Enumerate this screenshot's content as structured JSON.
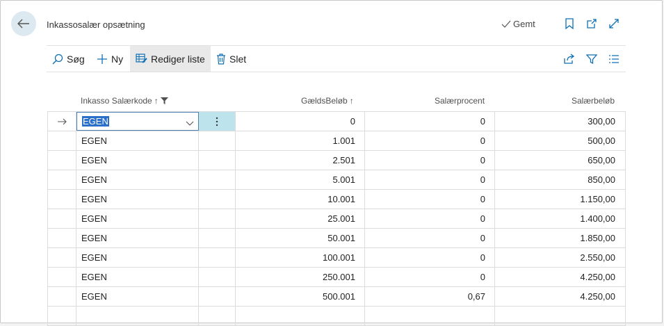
{
  "header": {
    "title": "Inkassosalær opsætning",
    "saved_label": "Gemt"
  },
  "actions": {
    "search": "Søg",
    "new": "Ny",
    "edit_list": "Rediger liste",
    "delete": "Slet"
  },
  "columns": {
    "code": "Inkasso Salærkode",
    "debt_amount": "GældsBeløb",
    "fee_percent": "Salærprocent",
    "fee_amount": "Salærbeløb"
  },
  "rows": [
    {
      "code": "EGEN",
      "debt": "0",
      "percent": "0",
      "fee": "300,00"
    },
    {
      "code": "EGEN",
      "debt": "1.001",
      "percent": "0",
      "fee": "500,00"
    },
    {
      "code": "EGEN",
      "debt": "2.501",
      "percent": "0",
      "fee": "650,00"
    },
    {
      "code": "EGEN",
      "debt": "5.001",
      "percent": "0",
      "fee": "850,00"
    },
    {
      "code": "EGEN",
      "debt": "10.001",
      "percent": "0",
      "fee": "1.150,00"
    },
    {
      "code": "EGEN",
      "debt": "25.001",
      "percent": "0",
      "fee": "1.400,00"
    },
    {
      "code": "EGEN",
      "debt": "50.001",
      "percent": "0",
      "fee": "1.850,00"
    },
    {
      "code": "EGEN",
      "debt": "100.001",
      "percent": "0",
      "fee": "2.550,00"
    },
    {
      "code": "EGEN",
      "debt": "250.001",
      "percent": "0",
      "fee": "4.250,00"
    },
    {
      "code": "EGEN",
      "debt": "500.001",
      "percent": "0,67",
      "fee": "4.250,00"
    }
  ],
  "colors": {
    "accent": "#2a6fc9",
    "icon_blue": "#0e6fb5",
    "selected_row_tint": "#bde4ec"
  }
}
